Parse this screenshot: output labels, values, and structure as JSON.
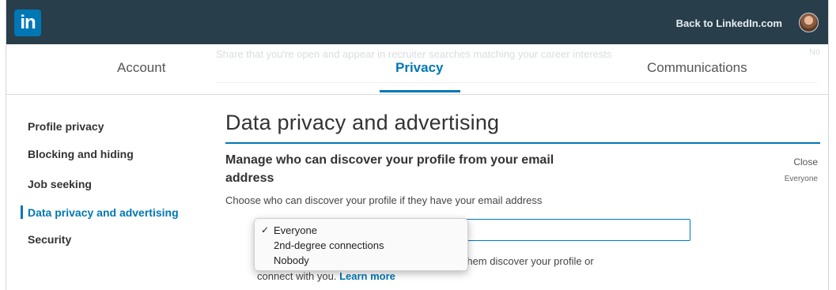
{
  "header": {
    "logo_text": "in",
    "back_link": "Back to LinkedIn.com"
  },
  "faded": {
    "text": "Share that you're open and appear in recruiter searches matching your career interests",
    "right": "No"
  },
  "tabs": [
    {
      "label": "Account"
    },
    {
      "label": "Privacy",
      "active": true
    },
    {
      "label": "Communications"
    }
  ],
  "sidebar": {
    "items": [
      {
        "label": "Profile privacy"
      },
      {
        "label": "Blocking and hiding"
      },
      {
        "label": "Job seeking"
      },
      {
        "label": "Data privacy and advertising",
        "active": true
      },
      {
        "label": "Security"
      }
    ]
  },
  "main": {
    "page_title": "Data privacy and advertising",
    "section_title": "Manage who can discover your profile from your email address",
    "close_label": "Close",
    "current_value": "Everyone",
    "description": "Choose who can discover your profile if they have your email address",
    "info_visible_end": "lp them discover your profile or",
    "info_line2": "connect with you.",
    "learn_more": "Learn more"
  },
  "dropdown": {
    "selected": "Everyone",
    "check_glyph": "✓",
    "options": [
      "Everyone",
      "2nd-degree connections",
      "Nobody"
    ]
  },
  "colors": {
    "topbar": "#283e4a",
    "accent": "#0077b5"
  }
}
